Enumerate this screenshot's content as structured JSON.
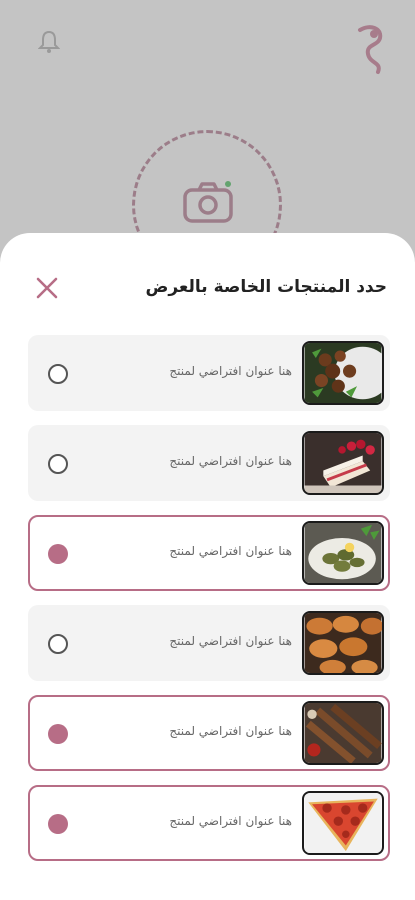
{
  "sheet": {
    "title": "حدد المنتجات الخاصة بالعرض"
  },
  "colors": {
    "accent": "#b76d86",
    "overlay": "#c4c4c4"
  },
  "products": [
    {
      "label": "هنا عنوان افتراضي لمنتج",
      "selected": false,
      "image": "meatballs-dish"
    },
    {
      "label": "هنا عنوان افتراضي لمنتج",
      "selected": false,
      "image": "cake-slice"
    },
    {
      "label": "هنا عنوان افتراضي لمنتج",
      "selected": true,
      "image": "stuffed-grape-leaves"
    },
    {
      "label": "هنا عنوان افتراضي لمنتج",
      "selected": false,
      "image": "croissants"
    },
    {
      "label": "هنا عنوان افتراضي لمنتج",
      "selected": true,
      "image": "kebab-skewers"
    },
    {
      "label": "هنا عنوان افتراضي لمنتج",
      "selected": true,
      "image": "pizza-slice"
    }
  ]
}
